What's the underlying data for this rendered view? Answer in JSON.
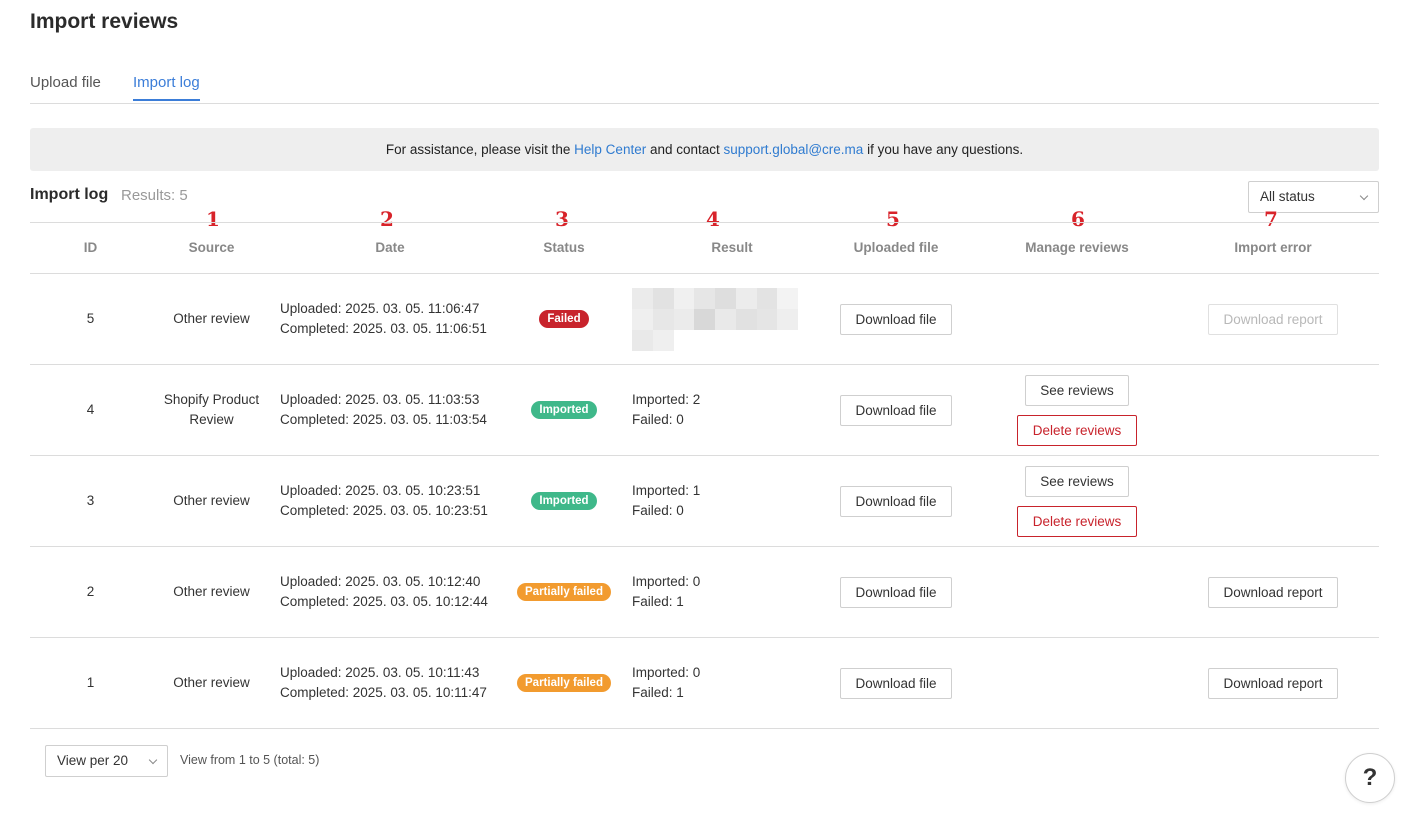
{
  "page": {
    "title": "Import reviews"
  },
  "tabs": [
    {
      "label": "Upload file",
      "active": false
    },
    {
      "label": "Import log",
      "active": true
    }
  ],
  "notice": {
    "prefix": "For assistance, please visit the ",
    "help_link": "Help Center",
    "middle": " and contact ",
    "email_link": "support.global@cre.ma",
    "suffix": " if you have any questions."
  },
  "log": {
    "heading": "Import log",
    "results": "Results: 5",
    "status_filter": "All status"
  },
  "markers": [
    "1",
    "2",
    "3",
    "4",
    "5",
    "6",
    "7"
  ],
  "columns": {
    "id": "ID",
    "source": "Source",
    "date": "Date",
    "status": "Status",
    "result": "Result",
    "file": "Uploaded file",
    "manage": "Manage reviews",
    "error": "Import error"
  },
  "rows": [
    {
      "id": "5",
      "source": "Other review",
      "uploaded": "Uploaded: 2025. 03. 05. 11:06:47",
      "completed": "Completed: 2025. 03. 05. 11:06:51",
      "status": "Failed",
      "imported": "",
      "failed": "",
      "file_btn": "Download file",
      "see_btn": "",
      "delete_btn": "",
      "report_btn": "Download report"
    },
    {
      "id": "4",
      "source": "Shopify Product Review",
      "uploaded": "Uploaded: 2025. 03. 05. 11:03:53",
      "completed": "Completed: 2025. 03. 05. 11:03:54",
      "status": "Imported",
      "imported": "Imported: 2",
      "failed": "Failed: 0",
      "file_btn": "Download file",
      "see_btn": "See reviews",
      "delete_btn": "Delete reviews",
      "report_btn": ""
    },
    {
      "id": "3",
      "source": "Other review",
      "uploaded": "Uploaded: 2025. 03. 05. 10:23:51",
      "completed": "Completed: 2025. 03. 05. 10:23:51",
      "status": "Imported",
      "imported": "Imported: 1",
      "failed": "Failed: 0",
      "file_btn": "Download file",
      "see_btn": "See reviews",
      "delete_btn": "Delete reviews",
      "report_btn": ""
    },
    {
      "id": "2",
      "source": "Other review",
      "uploaded": "Uploaded: 2025. 03. 05. 10:12:40",
      "completed": "Completed: 2025. 03. 05. 10:12:44",
      "status": "Partially failed",
      "imported": "Imported: 0",
      "failed": "Failed: 1",
      "file_btn": "Download file",
      "see_btn": "",
      "delete_btn": "",
      "report_btn": "Download report"
    },
    {
      "id": "1",
      "source": "Other review",
      "uploaded": "Uploaded: 2025. 03. 05. 10:11:43",
      "completed": "Completed: 2025. 03. 05. 10:11:47",
      "status": "Partially failed",
      "imported": "Imported: 0",
      "failed": "Failed: 1",
      "file_btn": "Download file",
      "see_btn": "",
      "delete_btn": "",
      "report_btn": "Download report"
    }
  ],
  "pagination": {
    "per_page": "View per 20",
    "info": "View from 1 to 5 (total: 5)"
  },
  "help": {
    "label": "?"
  },
  "colors": {
    "accent": "#3b7dd8",
    "failed": "#c8232c",
    "imported": "#3fb88a",
    "partial": "#f29b2f",
    "marker": "#d8232a"
  }
}
